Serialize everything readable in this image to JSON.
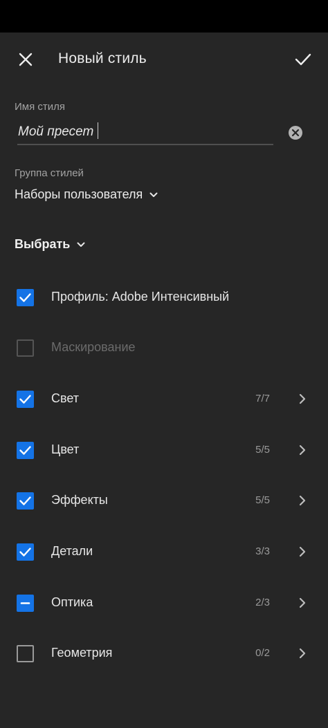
{
  "header": {
    "title": "Новый стиль"
  },
  "name_field": {
    "label": "Имя стиля",
    "value": "Мой пресет"
  },
  "group_field": {
    "label": "Группа стилей",
    "value": "Наборы пользователя"
  },
  "select_menu": {
    "label": "Выбрать"
  },
  "settings": [
    {
      "label": "Профиль: Adobe Интенсивный",
      "state": "checked",
      "count": ""
    },
    {
      "label": "Маскирование",
      "state": "disabled",
      "count": ""
    },
    {
      "label": "Свет",
      "state": "checked",
      "count": "7/7"
    },
    {
      "label": "Цвет",
      "state": "checked",
      "count": "5/5"
    },
    {
      "label": "Эффекты",
      "state": "checked",
      "count": "5/5"
    },
    {
      "label": "Детали",
      "state": "checked",
      "count": "3/3"
    },
    {
      "label": "Оптика",
      "state": "partial",
      "count": "2/3"
    },
    {
      "label": "Геометрия",
      "state": "unchecked",
      "count": "0/2"
    }
  ],
  "colors": {
    "background": "#262626",
    "accent": "#1473e6",
    "status_bar": "#000000"
  }
}
